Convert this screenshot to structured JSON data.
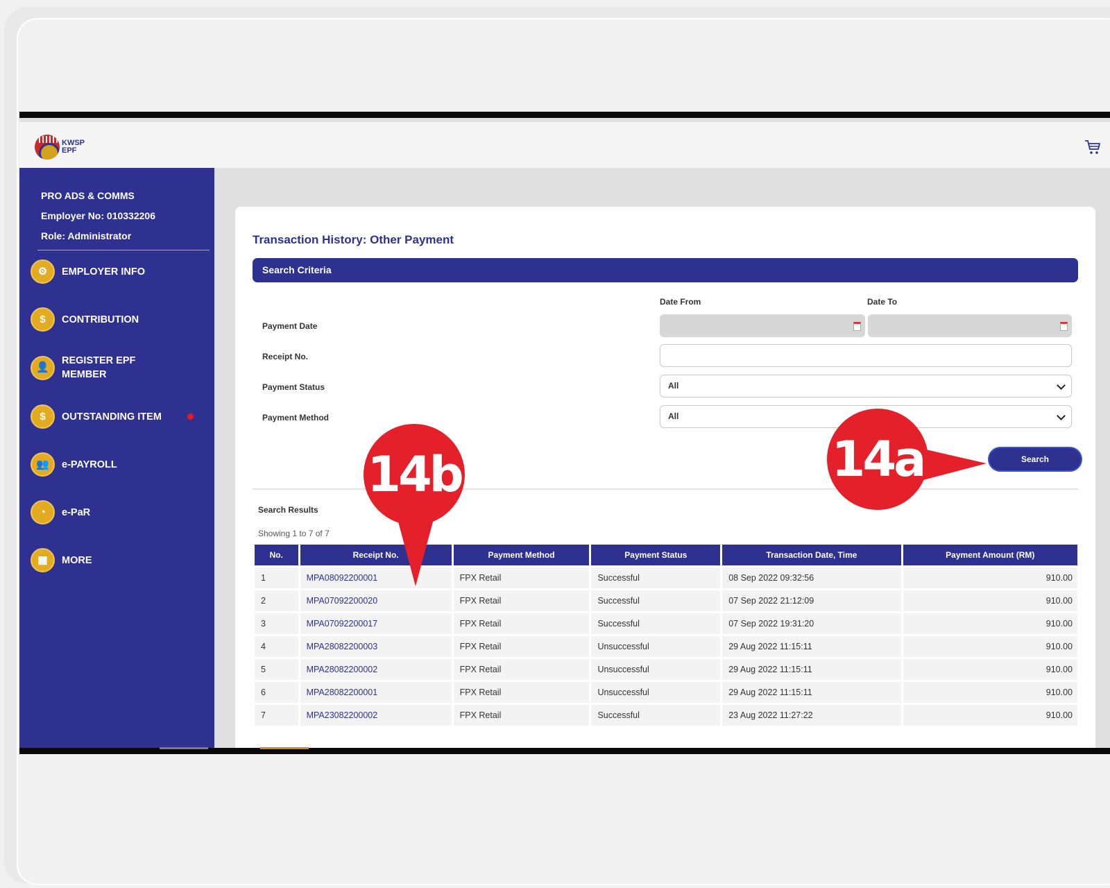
{
  "header": {
    "logo_line1": "KWSP",
    "logo_line2": "EPF",
    "cart_icon": "cart-icon"
  },
  "sidebar": {
    "company": "PRO ADS & COMMS",
    "employer_no": "Employer No: 010332206",
    "role": "Role: Administrator",
    "items": [
      {
        "label": "EMPLOYER INFO",
        "icon": "gear-icon",
        "glyph": "⚙"
      },
      {
        "label": "CONTRIBUTION",
        "icon": "dollar-hand-icon",
        "glyph": "$"
      },
      {
        "label": "REGISTER EPF MEMBER",
        "icon": "add-member-icon",
        "glyph": "👤"
      },
      {
        "label": "OUTSTANDING ITEM",
        "icon": "money-bag-icon",
        "glyph": "$",
        "notification": true
      },
      {
        "label": "e-PAYROLL",
        "icon": "payroll-icon",
        "glyph": "👥"
      },
      {
        "label": "e-PaR",
        "icon": "pie-chart-icon",
        "glyph": "◔"
      },
      {
        "label": "MORE",
        "icon": "grid-icon",
        "glyph": "▦"
      }
    ]
  },
  "main": {
    "title": "Transaction History: Other Payment",
    "criteria_title": "Search Criteria",
    "date_from_label": "Date From",
    "date_to_label": "Date To",
    "fields": {
      "payment_date": "Payment Date",
      "receipt_no": "Receipt No.",
      "payment_status": "Payment Status",
      "payment_method": "Payment Method"
    },
    "payment_status_value": "All",
    "payment_method_value": "All",
    "search_label": "Search",
    "results_label": "Search Results",
    "showing": "Showing 1 to 7 of 7",
    "columns": [
      "No.",
      "Receipt No.",
      "Payment Method",
      "Payment Status",
      "Transaction Date, Time",
      "Payment Amount (RM)"
    ],
    "rows": [
      [
        "1",
        "MPA08092200001",
        "FPX Retail",
        "Successful",
        "08 Sep 2022 09:32:56",
        "910.00"
      ],
      [
        "2",
        "MPA07092200020",
        "FPX Retail",
        "Successful",
        "07 Sep 2022 21:12:09",
        "910.00"
      ],
      [
        "3",
        "MPA07092200017",
        "FPX Retail",
        "Successful",
        "07 Sep 2022 19:31:20",
        "910.00"
      ],
      [
        "4",
        "MPA28082200003",
        "FPX Retail",
        "Unsuccessful",
        "29 Aug 2022 11:15:11",
        "910.00"
      ],
      [
        "5",
        "MPA28082200002",
        "FPX Retail",
        "Unsuccessful",
        "29 Aug 2022 11:15:11",
        "910.00"
      ],
      [
        "6",
        "MPA28082200001",
        "FPX Retail",
        "Unsuccessful",
        "29 Aug 2022 11:15:11",
        "910.00"
      ],
      [
        "7",
        "MPA23082200002",
        "FPX Retail",
        "Successful",
        "23 Aug 2022 11:27:22",
        "910.00"
      ]
    ]
  },
  "callouts": {
    "a": "14a",
    "b": "14b",
    "color": "#e4202a"
  },
  "colors": {
    "brand": "#2e318f",
    "accent": "#e3ab22"
  }
}
